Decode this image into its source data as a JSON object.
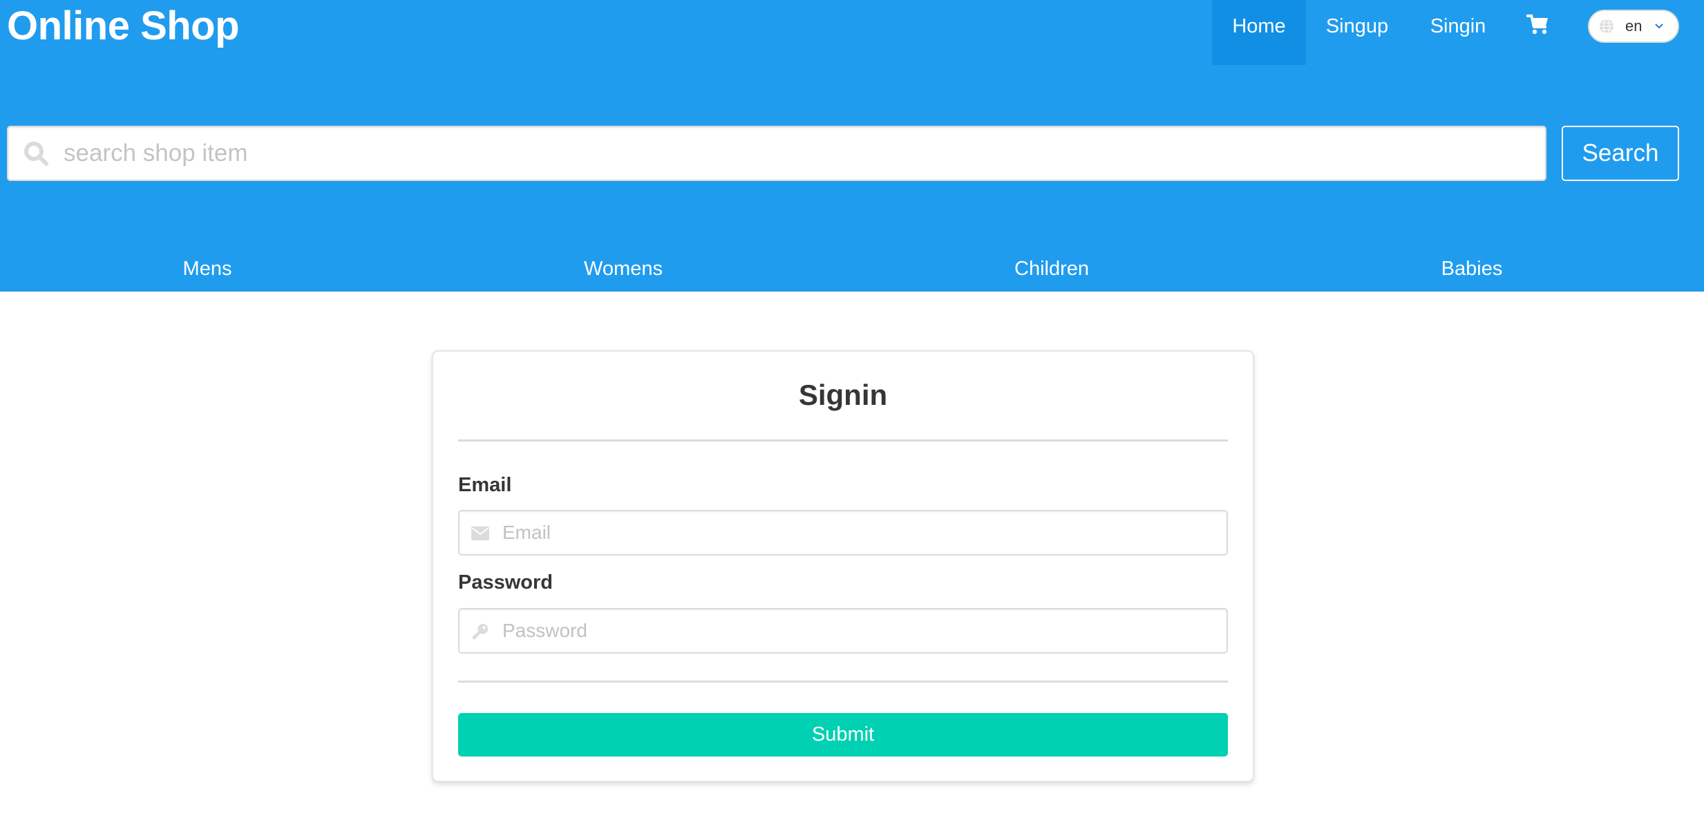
{
  "header": {
    "brand": "Online Shop",
    "nav": {
      "home": "Home",
      "signup": "Singup",
      "signin": "Singin",
      "cart_icon": "cart-icon",
      "active": "Home"
    },
    "language": {
      "icon": "globe-icon",
      "selected": "en",
      "dropdown_icon": "chevron-down-icon"
    },
    "search": {
      "icon": "search-icon",
      "placeholder": "search shop item",
      "value": "",
      "button_label": "Search"
    },
    "categories": [
      "Mens",
      "Womens",
      "Children",
      "Babies"
    ]
  },
  "signin_form": {
    "title": "Signin",
    "email": {
      "label": "Email",
      "placeholder": "Email",
      "value": "",
      "icon": "envelope-icon"
    },
    "password": {
      "label": "Password",
      "placeholder": "Password",
      "value": "",
      "icon": "key-icon"
    },
    "submit_label": "Submit"
  },
  "colors": {
    "header_bg": "#209cee",
    "nav_active_bg": "#118fe4",
    "submit_bg": "#00d1b2",
    "text_dark": "#363636",
    "border": "#dbdbdb"
  }
}
